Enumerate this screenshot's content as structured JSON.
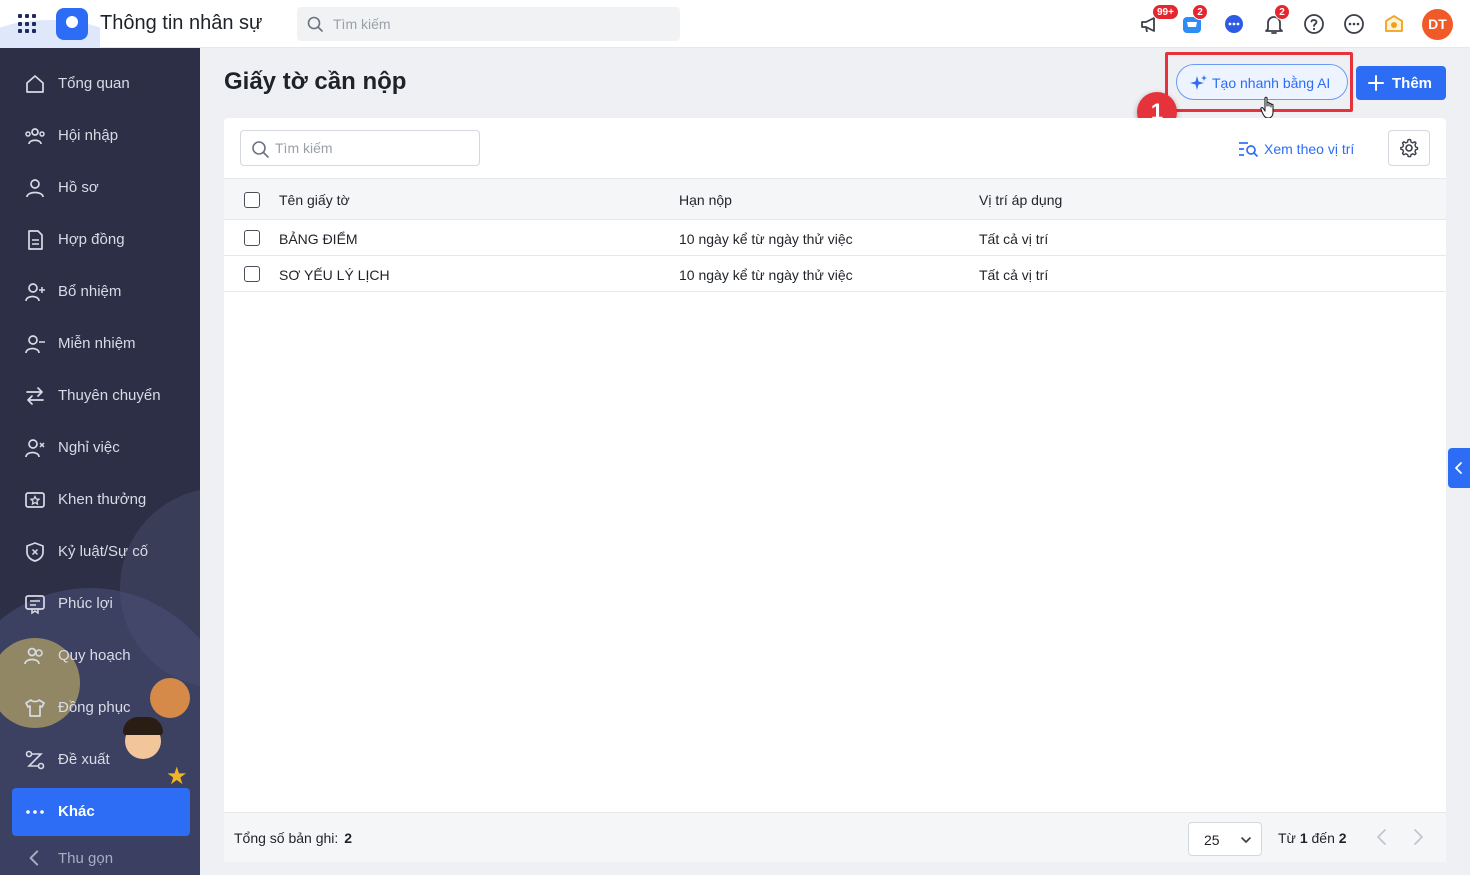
{
  "header": {
    "app_title": "Thông tin nhân sự",
    "search_placeholder": "Tìm kiếm",
    "badges": {
      "announcements": "99+",
      "cart": "2",
      "notifications": "2"
    },
    "avatar_initials": "DT"
  },
  "sidebar": {
    "items": [
      {
        "label": "Tổng quan",
        "icon": "home-icon"
      },
      {
        "label": "Hội nhập",
        "icon": "group-icon"
      },
      {
        "label": "Hồ sơ",
        "icon": "user-icon"
      },
      {
        "label": "Hợp đồng",
        "icon": "document-icon"
      },
      {
        "label": "Bổ nhiệm",
        "icon": "user-add-icon"
      },
      {
        "label": "Miễn nhiệm",
        "icon": "user-remove-icon"
      },
      {
        "label": "Thuyên chuyển",
        "icon": "transfer-icon"
      },
      {
        "label": "Nghỉ việc",
        "icon": "user-x-icon"
      },
      {
        "label": "Khen thưởng",
        "icon": "reward-icon"
      },
      {
        "label": "Kỷ luật/Sự cố",
        "icon": "shield-x-icon"
      },
      {
        "label": "Phúc lợi",
        "icon": "benefit-icon"
      },
      {
        "label": "Quy hoạch",
        "icon": "users-plan-icon"
      },
      {
        "label": "Đồng phục",
        "icon": "shirt-icon"
      },
      {
        "label": "Đề xuất",
        "icon": "proposal-icon"
      },
      {
        "label": "Khác",
        "icon": "more-dots-icon",
        "active": true
      }
    ],
    "collapse_label": "Thu gọn"
  },
  "main": {
    "title": "Giấy tờ cần nộp",
    "ai_button_label": "Tạo nhanh bằng AI",
    "add_button_label": "Thêm",
    "step_number": "1",
    "search_placeholder": "Tìm kiếm",
    "view_by_position_label": "Xem theo vị trí",
    "table": {
      "columns": [
        "Tên giấy tờ",
        "Hạn nộp",
        "Vị trí áp dụng"
      ],
      "rows": [
        [
          "BẢNG ĐIỂM",
          "10 ngày kể từ ngày thử việc",
          "Tất cả vị trí"
        ],
        [
          "SƠ YẾU LÝ LỊCH",
          "10 ngày kể từ ngày thử việc",
          "Tất cả vị trí"
        ]
      ]
    },
    "footer": {
      "total_label": "Tổng số bản ghi:",
      "total_value": "2",
      "page_size": "25",
      "range_prefix": "Từ",
      "range_from": "1",
      "range_mid": "đến",
      "range_to": "2"
    }
  },
  "colors": {
    "primary": "#2d6df5",
    "sidebar_bg": "#2c2f45",
    "highlight_red": "#e5323b",
    "badge_red": "#e5262f",
    "avatar": "#f05a28"
  }
}
